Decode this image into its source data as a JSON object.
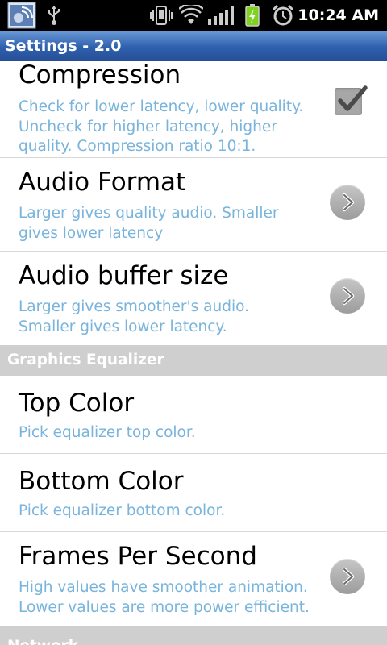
{
  "status_bar": {
    "time": "10:24 AM",
    "icons": [
      "app-notification-icon",
      "usb-icon",
      "vibrate-icon",
      "wifi-icon",
      "signal-icon",
      "battery-charging-icon",
      "alarm-icon"
    ]
  },
  "title_bar": {
    "title": "Settings - 2.0"
  },
  "preferences": [
    {
      "title": "Compression",
      "summary": "Check for lower latency, lower quality. Uncheck for higher latency, higher quality. Compression ratio 10:1.",
      "widget": "checkbox",
      "checked": true
    },
    {
      "title": "Audio Format",
      "summary": "Larger gives quality audio. Smaller gives lower latency",
      "widget": "arrow"
    },
    {
      "title": "Audio buffer size",
      "summary": "Larger gives smoother's audio. Smaller gives lower latency.",
      "widget": "arrow"
    }
  ],
  "categories": [
    {
      "label": "Graphics Equalizer"
    },
    {
      "label": "Network"
    }
  ],
  "graphics_preferences": [
    {
      "title": "Top Color",
      "summary": "Pick equalizer top color.",
      "widget": "none"
    },
    {
      "title": "Bottom Color",
      "summary": "Pick equalizer bottom color.",
      "widget": "none"
    },
    {
      "title": "Frames Per Second",
      "summary": "High values have smoother animation. Lower values are more power efficient.",
      "widget": "arrow"
    }
  ],
  "colors": {
    "summary_text": "#78b4dc",
    "category_bg": "#cfcfcf",
    "titlebar": "#2e5fae",
    "battery": "#7ed321"
  }
}
